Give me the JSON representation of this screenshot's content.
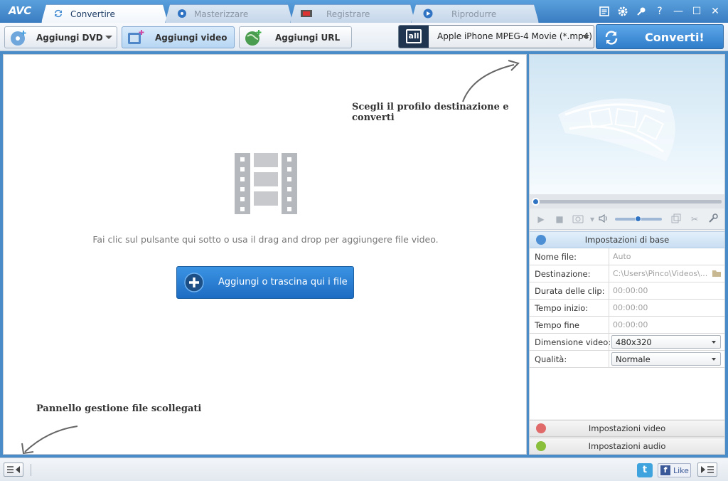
{
  "app": {
    "logo": "AVC"
  },
  "tabs": [
    {
      "label": "Convertire",
      "icon": "convert-icon",
      "active": true
    },
    {
      "label": "Masterizzare",
      "icon": "disc-icon",
      "active": false
    },
    {
      "label": "Registrare",
      "icon": "record-icon",
      "active": false
    },
    {
      "label": "Riprodurre",
      "icon": "play-icon",
      "active": false
    }
  ],
  "window_controls": [
    "list-icon",
    "gear-icon",
    "key-icon",
    "help-icon",
    "minimize-icon",
    "maximize-icon",
    "close-icon"
  ],
  "window_glyphs": {
    "help": "?",
    "minimize": "—",
    "maximize": "☐",
    "close": "✕"
  },
  "toolbar": {
    "add_dvd": "Aggiungi DVD",
    "add_video": "Aggiungi video",
    "add_url": "Aggiungi URL"
  },
  "profile": {
    "icon_text": "all",
    "label": "Apple iPhone MPEG-4 Movie (*.mp4)"
  },
  "convert_button": "Converti!",
  "main": {
    "annotation_profile": "Scegli il profilo destinazione e converti",
    "annotation_panel": "Pannello gestione file scollegati",
    "hint": "Fai clic sul pulsante qui sotto o usa il drag and drop per aggiungere file video.",
    "add_files_button": "Aggiungi o trascina qui i file"
  },
  "settings": {
    "basic_header": "Impostazioni di base",
    "rows": [
      {
        "key": "Nome file:",
        "value": "Auto",
        "type": "text"
      },
      {
        "key": "Destinazione:",
        "value": "C:\\Users\\Pinco\\Videos\\...",
        "type": "text"
      },
      {
        "key": "Durata delle clip:",
        "value": "00:00:00",
        "type": "text"
      },
      {
        "key": "Tempo inizio:",
        "value": "00:00:00",
        "type": "text"
      },
      {
        "key": "Tempo fine",
        "value": "00:00:00",
        "type": "text"
      },
      {
        "key": "Dimensione video:",
        "value": "480x320",
        "type": "select"
      },
      {
        "key": "Qualità:",
        "value": "Normale",
        "type": "select"
      }
    ],
    "video_header": "Impostazioni video",
    "audio_header": "Impostazioni audio"
  },
  "statusbar": {
    "twitter": "t",
    "like_icon": "f",
    "like": "Like"
  },
  "colors": {
    "accent": "#2f7cc9",
    "titlebar": "#4a8cc7"
  }
}
